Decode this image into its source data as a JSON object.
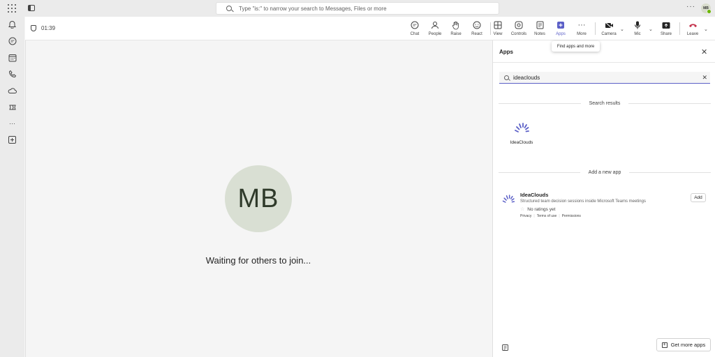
{
  "title_bar": {
    "search_placeholder": "Type \"is:\" to narrow your search to Messages, Files or more",
    "more_label": "···",
    "user_initials": "MB"
  },
  "rail": {
    "icons": [
      "bell-icon",
      "chat-icon",
      "calendar-icon",
      "calls-icon",
      "onedrive-icon",
      "copilot-icon",
      "more-apps-icon",
      "add-apps-icon"
    ]
  },
  "meeting": {
    "timer": "01:39",
    "buttons": {
      "chat": "Chat",
      "people": "People",
      "raise": "Raise",
      "react": "React",
      "view": "View",
      "controls": "Controls",
      "notes": "Notes",
      "apps": "Apps",
      "more": "More",
      "camera": "Camera",
      "mic": "Mic",
      "share": "Share",
      "leave": "Leave"
    },
    "tooltip": "Find apps and more",
    "participant_initials": "MB",
    "status_text": "Waiting for others to join..."
  },
  "apps_panel": {
    "title": "Apps",
    "search_value": "ideaclouds",
    "search_results_heading": "Search results",
    "result_tile_label": "IdeaClouds",
    "add_new_heading": "Add a new app",
    "app": {
      "name": "IdeaClouds",
      "description": "Structured team decision sessions inside Microsoft Teams meetings",
      "rating_text": "No ratings yet",
      "links": [
        "Privacy",
        "Terms of use",
        "Permissions"
      ],
      "add_label": "Add"
    },
    "get_more_label": "Get more apps"
  },
  "colors": {
    "accent": "#5b5fc7",
    "leave": "#c4314b",
    "avatar_bg": "#d9dfd3",
    "logo": "#5b5fc7"
  }
}
